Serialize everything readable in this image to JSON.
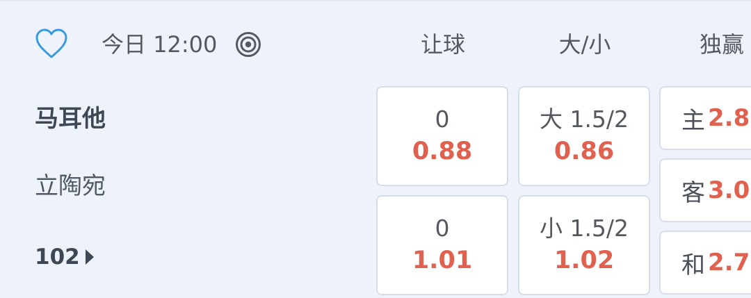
{
  "header": {
    "time": "今日 12:00",
    "columns": [
      "让球",
      "大/小",
      "独赢"
    ]
  },
  "match": {
    "home": "马耳他",
    "away": "立陶宛",
    "more_count": "102"
  },
  "handicap": [
    {
      "line": "0",
      "odds": "0.88"
    },
    {
      "line": "0",
      "odds": "1.01"
    }
  ],
  "overunder": [
    {
      "line": "大 1.5/2",
      "odds": "0.86"
    },
    {
      "line": "小 1.5/2",
      "odds": "1.02"
    }
  ],
  "moneyline": [
    {
      "label": "主",
      "odds": "2.8"
    },
    {
      "label": "客",
      "odds": "3.0"
    },
    {
      "label": "和",
      "odds": "2.7"
    }
  ],
  "colors": {
    "accent_blue": "#3a9ad9",
    "odds_red": "#e0614f",
    "background": "#eef3fb"
  }
}
